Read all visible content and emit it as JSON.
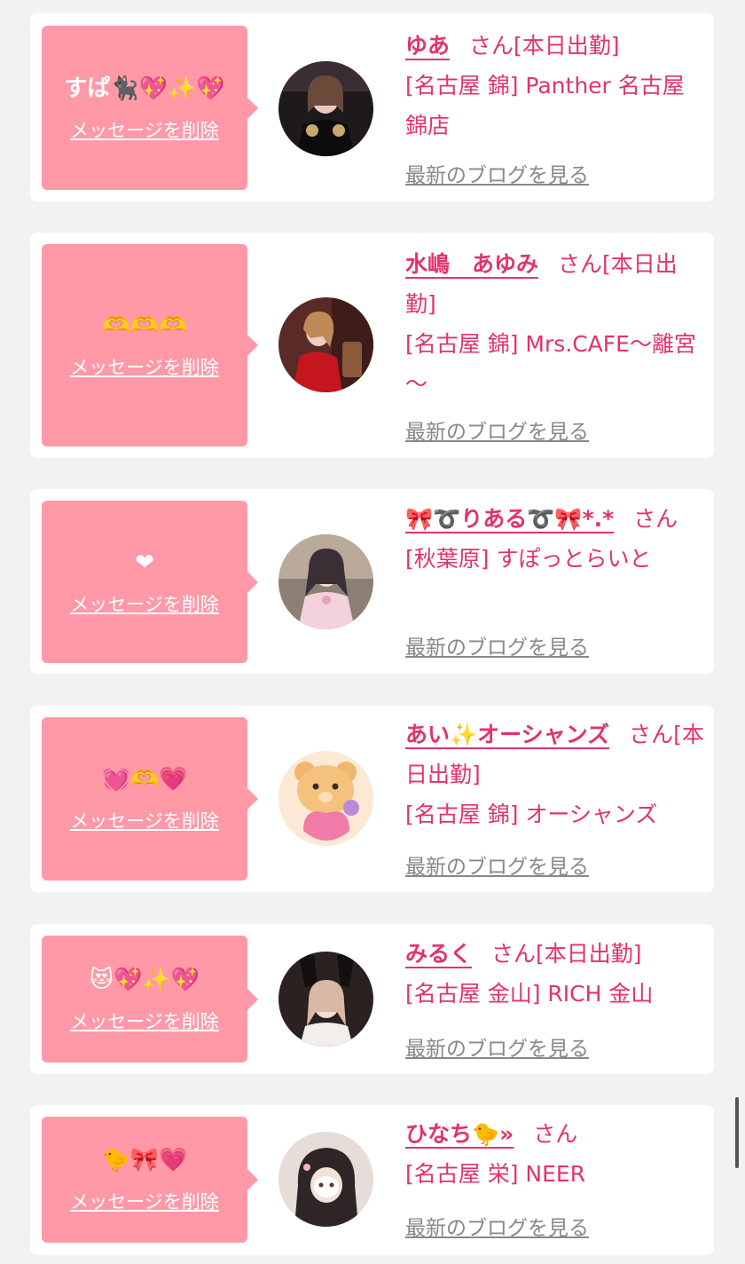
{
  "cards": [
    {
      "message": "すぱ🐈‍⬛💖✨💖",
      "delete_label": "メッセージを削除",
      "name": "ゆあ",
      "san": "さん",
      "shift": "[本日出勤]",
      "shop": "[名古屋 錦] Panther 名古屋錦店",
      "blog_label": "最新のブログを見る"
    },
    {
      "message": "🫶🫶🫶",
      "delete_label": "メッセージを削除",
      "name": "水嶋　あゆみ",
      "san": "さん",
      "shift": "[本日出勤]",
      "shop": "[名古屋 錦] Mrs.CAFE～離宮～",
      "blog_label": "最新のブログを見る"
    },
    {
      "message": "❤",
      "delete_label": "メッセージを削除",
      "name": "🎀➰りある➰🎀*.*",
      "san": "さん",
      "shift": "",
      "shop": "[秋葉原] すぽっとらいと",
      "blog_label": "最新のブログを見る"
    },
    {
      "message": "💓🫶💗",
      "delete_label": "メッセージを削除",
      "name": "あい✨オーシャンズ",
      "san": "さん",
      "shift": "[本日出勤]",
      "shop": "[名古屋 錦] オーシャンズ",
      "blog_label": "最新のブログを見る"
    },
    {
      "message": "😻💖✨💖",
      "delete_label": "メッセージを削除",
      "name": "みるく",
      "san": "さん",
      "shift": "[本日出勤]",
      "shop": "[名古屋 金山] RICH 金山",
      "blog_label": "最新のブログを見る"
    },
    {
      "message": "🐤🎀💗",
      "delete_label": "メッセージを削除",
      "name": "ひなち🐤»",
      "san": "さん",
      "shift": "",
      "shop": "[名古屋 栄] NEER",
      "blog_label": "最新のブログを見る"
    }
  ],
  "colors": {
    "bubble": "#ff99a8",
    "accent": "#e2336a",
    "link_gray": "#888888",
    "page_bg": "#f2f2f2"
  }
}
